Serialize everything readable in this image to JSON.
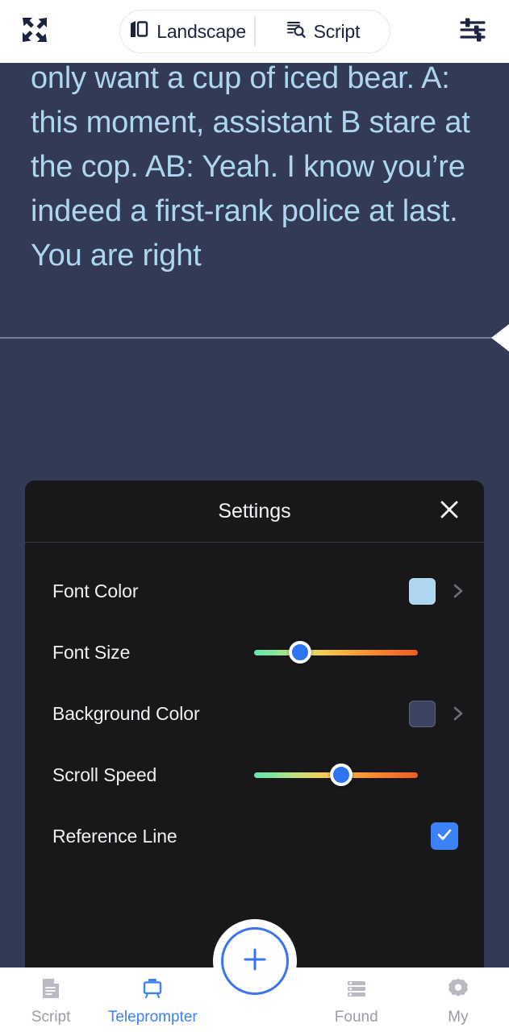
{
  "topbar": {
    "expand_icon": "fullscreen-expand-icon",
    "tune_icon": "tune-sliders-icon",
    "segments": [
      {
        "label": "Landscape",
        "icon": "screen-rotate-icon"
      },
      {
        "label": "Script",
        "icon": "script-search-icon"
      }
    ]
  },
  "prompter": {
    "text": "only want a cup of iced bear. A: this moment, assistant B stare at the cop. AB: Yeah. I know you’re indeed a first-rank police at last. You are right",
    "font_color": "#aed6ef",
    "background_color": "#333a55",
    "reference_line_visible": true
  },
  "play_control": {
    "icon": "play-triangle-icon"
  },
  "settings": {
    "title": "Settings",
    "close_icon": "close-x-icon",
    "rows": [
      {
        "label": "Font Color",
        "type": "color",
        "value": "#aed6ef",
        "chevron_icon": "chevron-right-icon"
      },
      {
        "label": "Font Size",
        "type": "slider",
        "value": 28
      },
      {
        "label": "Background Color",
        "type": "color",
        "value": "#3b4263",
        "chevron_icon": "chevron-right-icon"
      },
      {
        "label": "Scroll Speed",
        "type": "slider",
        "value": 53
      },
      {
        "label": "Reference Line",
        "type": "checkbox",
        "checked": true,
        "check_icon": "check-icon"
      }
    ]
  },
  "bottomnav": {
    "items": [
      {
        "label": "Script",
        "icon": "script-document-icon",
        "active": false
      },
      {
        "label": "Teleprompter",
        "icon": "teleprompter-easel-icon",
        "active": true
      },
      {
        "label": "",
        "icon": "plus-icon",
        "active": false
      },
      {
        "label": "Found",
        "icon": "list-rows-icon",
        "active": false
      },
      {
        "label": "My",
        "icon": "gear-icon",
        "active": false
      }
    ],
    "fab_icon": "plus-icon",
    "accent_color": "#3b82f6"
  }
}
